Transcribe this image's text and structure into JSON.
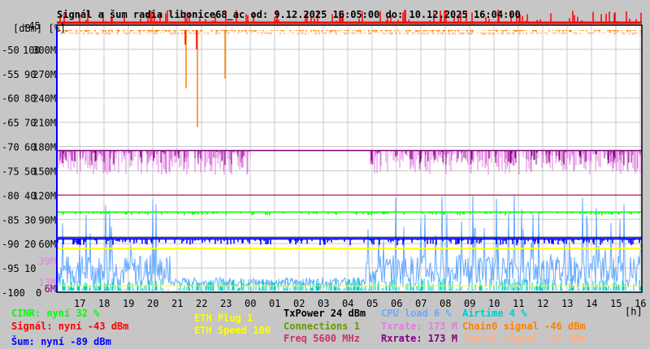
{
  "chart_data": {
    "type": "line",
    "title": "Signál a šum radia libonice68_ac od: 9.12.2025 16:05:00 do: 10.12.2025 16:04:00",
    "ylabel": "[dBm] [%]",
    "xlabel": "[h]",
    "ylim": [
      -100,
      -45
    ],
    "y_ticks_dbm": [
      "-45",
      "-50",
      "-55",
      "-60",
      "-65",
      "-70",
      "-75",
      "-80",
      "-85",
      "-90",
      "-95",
      "-100"
    ],
    "y_ticks_pct": [
      "100",
      "90",
      "80",
      "70",
      "60",
      "50",
      "40",
      "30",
      "20",
      "10",
      "0"
    ],
    "y_ticks_rate": [
      "300M",
      "270M",
      "240M",
      "210M",
      "180M",
      "150M",
      "120M",
      "90M",
      "60M"
    ],
    "y_ticks_rate_small": [
      {
        "label": "39M",
        "color": "#e080e0"
      },
      {
        "label": "13M",
        "color": "#e080e0"
      },
      {
        "label": "6M",
        "color": "#800080"
      }
    ],
    "x_ticks": [
      "17",
      "18",
      "19",
      "20",
      "21",
      "22",
      "23",
      "00",
      "01",
      "02",
      "03",
      "04",
      "05",
      "06",
      "07",
      "08",
      "09",
      "10",
      "11",
      "12",
      "13",
      "14",
      "15",
      "16"
    ],
    "grid": true,
    "series": [
      {
        "name": "Signal",
        "color": "#ff0000",
        "level_dbm": -43
      },
      {
        "name": "Chain0 signal",
        "color": "#ff8000",
        "level_dbm": -46
      },
      {
        "name": "Chain1 signal",
        "color": "#ffb080",
        "level_dbm": -47
      },
      {
        "name": "Noise",
        "color": "#0000ff",
        "level_dbm": -89
      },
      {
        "name": "CINR",
        "color": "#00ff00",
        "level_pct": 32
      },
      {
        "name": "Txrate",
        "color": "#e080e0",
        "level_mbps": 173
      },
      {
        "name": "Rxrate",
        "color": "#800080",
        "level_mbps": 173
      },
      {
        "name": "Freq",
        "color": "#cc3366",
        "level": 5600
      },
      {
        "name": "ETH Speed",
        "color": "#ffff00",
        "level": 100
      },
      {
        "name": "CPU load",
        "color": "#66aaff",
        "level_pct": 6
      },
      {
        "name": "Airtime",
        "color": "#00cccc",
        "level_pct": 4
      }
    ]
  },
  "legend": {
    "cinr": "CINR: nyní 32 %",
    "signal": "Signál: nyní -43 dBm",
    "noise": "Šum: nyní -89 dBm",
    "eth_plug": "ETH Plug 1",
    "eth_speed": "ETH Speed 100",
    "txpower": "TxPower 24 dBm",
    "connections": "Connections 1",
    "freq": "Freq 5600 MHz",
    "cpu": "CPU load 6 %",
    "txrate": "Txrate: 173 M",
    "rxrate": "Rxrate: 173 M",
    "airtime": "Airtime 4 %",
    "chain0": "Chain0 signal -46 dBm",
    "chain1": "Chain1 signal -47 dBm"
  },
  "colors": {
    "signal": "#ff0000",
    "chain0": "#ff8000",
    "chain1": "#ffb080",
    "noise": "#0000ff",
    "cinr": "#00ff00",
    "txrate": "#e080e0",
    "rxrate": "#800080",
    "freq": "#cc3366",
    "eth": "#ffff00",
    "cpu": "#66aaff",
    "airtime": "#00cccc",
    "connections": "#669900",
    "txpower": "#000000"
  }
}
